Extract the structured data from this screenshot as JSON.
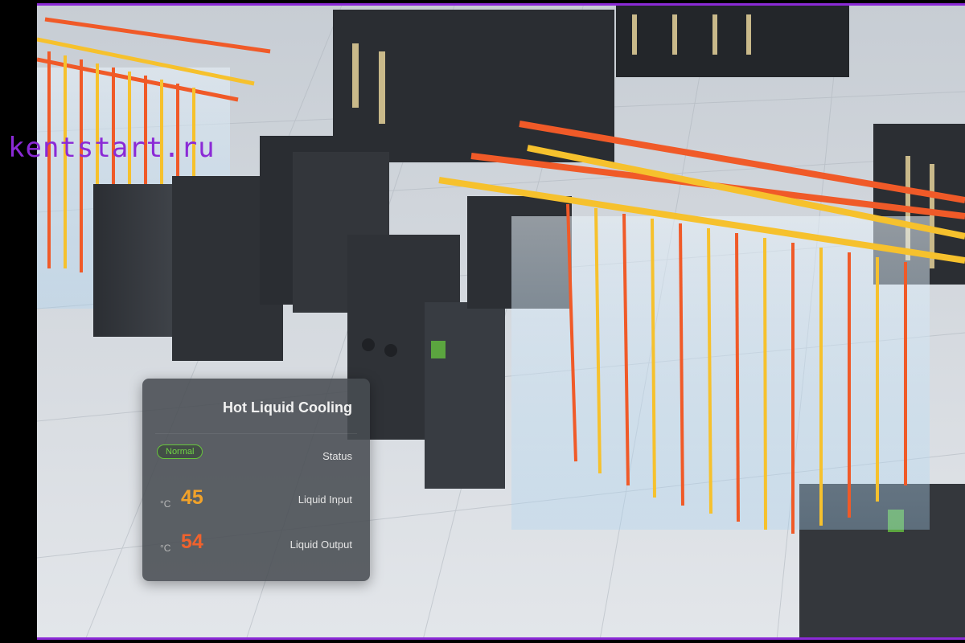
{
  "watermark": "kentstart.ru",
  "panel": {
    "title": "Hot Liquid Cooling",
    "status_label": "Status",
    "status_value": "Normal",
    "input_label": "Liquid Input",
    "input_value": "45",
    "output_label": "Liquid Output",
    "output_value": "54",
    "unit": "°C"
  },
  "colors": {
    "status_normal": "#6fd443",
    "input_value": "#f1a22a",
    "output_value": "#f0622d",
    "hot_pipe": "#f05a28",
    "warm_pipe": "#f6c12d",
    "border": "#8b2ad6"
  }
}
